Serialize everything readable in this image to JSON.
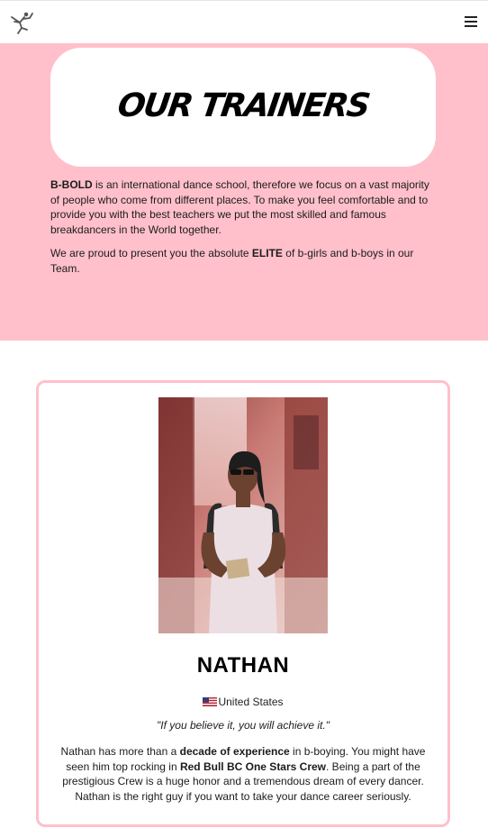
{
  "nav": {
    "logo": "dancer-logo-icon",
    "menu_icon": "hamburger-menu-icon"
  },
  "hero": {
    "title": "OUR TRAINERS",
    "intro_brand": "B-BOLD",
    "intro_p1_rest": " is an international dance school, therefore we focus on a vast majority of people who come from different places. To make you feel comfortable and to provide you with the best teachers we put the most skilled and famous breakdancers in the World together.",
    "intro_p2_start": "We are proud to present you the absolute ",
    "intro_p2_bold": "ELITE",
    "intro_p2_end": " of b-girls and b-boys in our Team."
  },
  "trainer": {
    "name": "NATHAN",
    "flag_icon": "us-flag-icon",
    "country": "United States",
    "quote": "\"If you believe it, you will achieve it.\"",
    "bio_1": "Nathan has more than a ",
    "bio_2": "decade of experience",
    "bio_3": " in b-boying. You might have seen him top rocking in ",
    "bio_4": "Red Bull BC One Stars Crew",
    "bio_5": ". Being a part of the prestigious Crew is a huge honor and a tremendous dream of every dancer. Nathan is the right guy if you want to take your dance career seriously."
  },
  "colors": {
    "hero_bg": "#ffc0cb",
    "card_border": "#ffc0cb"
  }
}
